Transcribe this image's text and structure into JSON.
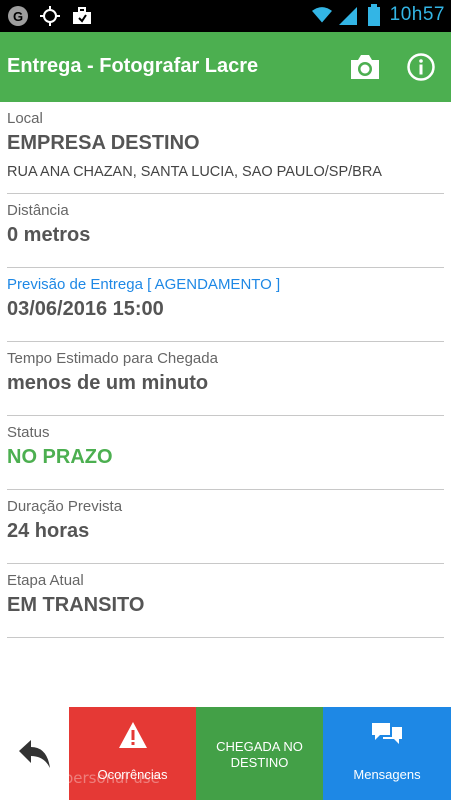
{
  "status_bar": {
    "time": "10h57",
    "icons": [
      "google-icon",
      "gps-icon",
      "briefcase-icon",
      "wifi-icon",
      "signal-icon",
      "battery-icon"
    ]
  },
  "app_bar": {
    "title": "Entrega - Fotografar Lacre",
    "actions": [
      "camera-icon",
      "info-icon"
    ],
    "color": "#4caf50"
  },
  "fields": {
    "local": {
      "label": "Local",
      "value": "EMPRESA DESTINO",
      "address": "RUA ANA CHAZAN, SANTA LUCIA, SAO PAULO/SP/BRA"
    },
    "distancia": {
      "label": "Distância",
      "value": "0 metros"
    },
    "previsao": {
      "label": "Previsão de Entrega  [ AGENDAMENTO ]",
      "value": "03/06/2016 15:00"
    },
    "tempo": {
      "label": "Tempo Estimado para Chegada",
      "value": "menos de um minuto"
    },
    "status": {
      "label": "Status",
      "value": "NO PRAZO"
    },
    "duracao": {
      "label": "Duração Prevista",
      "value": "24 horas"
    },
    "etapa": {
      "label": "Etapa Atual",
      "value": "EM TRANSITO"
    }
  },
  "bottom_bar": {
    "back_icon": "back-arrow-icon",
    "ocorrencias": "Ocorrências",
    "chegada": "CHEGADA NO DESTINO",
    "mensagens": "Mensagens",
    "colors": {
      "red": "#e53935",
      "green": "#43a047",
      "blue": "#1e88e5"
    }
  },
  "watermark": "free for personal use"
}
